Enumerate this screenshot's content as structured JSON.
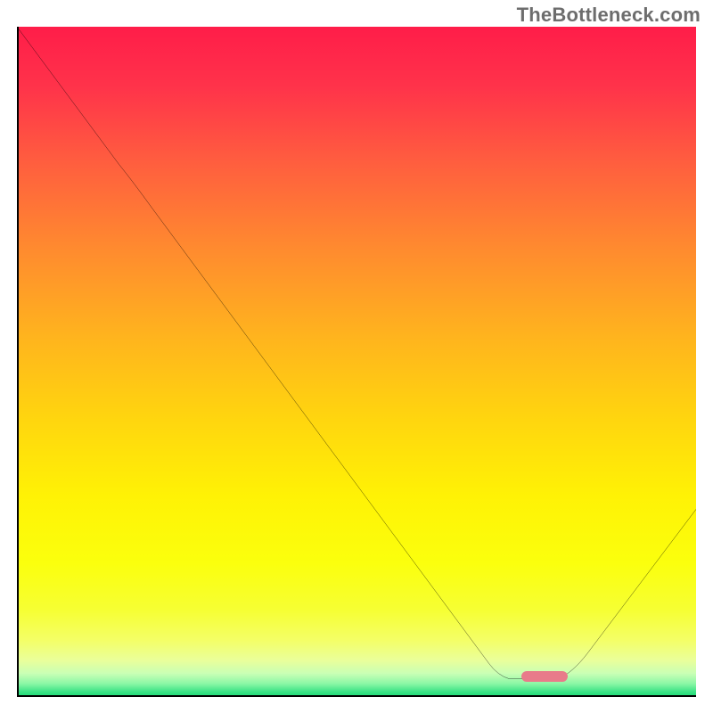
{
  "chart_data": {
    "type": "line",
    "watermark": "TheBottleneck.com",
    "title": "",
    "xlabel": "",
    "ylabel": "",
    "xlim": [
      0,
      100
    ],
    "ylim": [
      0,
      100
    ],
    "grid": false,
    "legend": false,
    "background_gradient_stops": [
      {
        "pos": 0.0,
        "color": "#ff1d49"
      },
      {
        "pos": 0.09,
        "color": "#ff334a"
      },
      {
        "pos": 0.2,
        "color": "#ff5d3f"
      },
      {
        "pos": 0.33,
        "color": "#ff8a2f"
      },
      {
        "pos": 0.46,
        "color": "#ffb31e"
      },
      {
        "pos": 0.58,
        "color": "#ffd40f"
      },
      {
        "pos": 0.7,
        "color": "#fff205"
      },
      {
        "pos": 0.8,
        "color": "#fbff0d"
      },
      {
        "pos": 0.87,
        "color": "#f6ff33"
      },
      {
        "pos": 0.915,
        "color": "#f4ff66"
      },
      {
        "pos": 0.945,
        "color": "#eaff9a"
      },
      {
        "pos": 0.965,
        "color": "#c9ffb5"
      },
      {
        "pos": 0.98,
        "color": "#8cf7a6"
      },
      {
        "pos": 0.992,
        "color": "#3de386"
      },
      {
        "pos": 1.0,
        "color": "#19d973"
      }
    ],
    "series": [
      {
        "name": "bottleneck-curve",
        "color": "#000000",
        "curve_points_percent": [
          {
            "x": 0.0,
            "y": 100.0
          },
          {
            "x": 15.0,
            "y": 79.5
          },
          {
            "x": 20.0,
            "y": 72.8
          },
          {
            "x": 69.5,
            "y": 5.0
          },
          {
            "x": 72.5,
            "y": 2.7
          },
          {
            "x": 79.7,
            "y": 2.7
          },
          {
            "x": 84.0,
            "y": 6.5
          },
          {
            "x": 100.0,
            "y": 28.0
          }
        ]
      }
    ],
    "marker": {
      "name": "optimal-range",
      "color": "#e87b8a",
      "x_range_percent": [
        74.3,
        81.1
      ],
      "y_percent": 3.1
    },
    "annotations": []
  }
}
